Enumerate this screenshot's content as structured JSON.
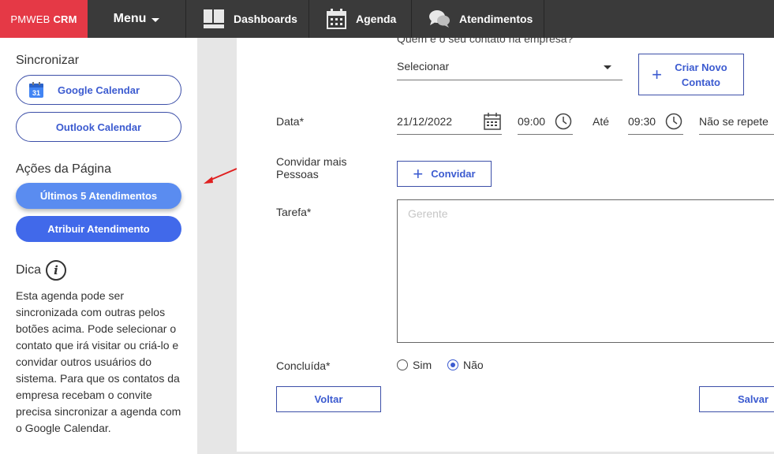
{
  "nav": {
    "brand_prefix": "PMWEB",
    "brand_bold": "CRM",
    "menu_label": "Menu",
    "items": [
      {
        "label": "Dashboards",
        "icon": "dashboard-icon"
      },
      {
        "label": "Agenda",
        "icon": "calendar-icon"
      },
      {
        "label": "Atendimentos",
        "icon": "chat-bubbles-icon"
      }
    ]
  },
  "sidebar": {
    "sync_heading": "Sincronizar",
    "google_calendar": "Google Calendar",
    "google_calendar_day": "31",
    "outlook_calendar": "Outlook Calendar",
    "actions_heading": "Ações da Página",
    "ultimos_atendimentos": "Últimos 5 Atendimentos",
    "atribuir_atendimento": "Atribuir Atendimento",
    "dica_heading": "Dica",
    "dica_icon_glyph": "i",
    "dica_text": "Esta agenda pode ser sincronizada com outras pelos botões acima. Pode selecionar o contato que irá visitar ou criá-lo e convidar outros usuários do sistema. Para que os contatos da empresa recebam o convite precisa sincronizar a agenda com o Google Calendar."
  },
  "form": {
    "contact_question": "Quem é o seu contato na empresa?",
    "contact_select": "Selecionar",
    "criar_novo_contato": "Criar Novo Contato",
    "data_label": "Data*",
    "date_value": "21/12/2022",
    "time_start": "09:00",
    "ate_label": "Até",
    "time_end": "09:30",
    "repeat_value": "Não se repete",
    "convidar_label": "Convidar mais Pessoas",
    "convidar_button": "Convidar",
    "tarefa_label": "Tarefa*",
    "tarefa_placeholder": "Gerente",
    "concluida_label": "Concluída*",
    "option_sim": "Sim",
    "option_nao": "Não",
    "selected_option": "Não",
    "voltar_button": "Voltar",
    "salvar_button": "Salvar"
  },
  "colors": {
    "brand_red": "#e53946",
    "nav_dark": "#3a3a3a",
    "accent_blue": "#3c5bd0",
    "button_blue": "#4169ea",
    "button_light_blue": "#5a8cf0",
    "annotation_red": "#e02020"
  }
}
